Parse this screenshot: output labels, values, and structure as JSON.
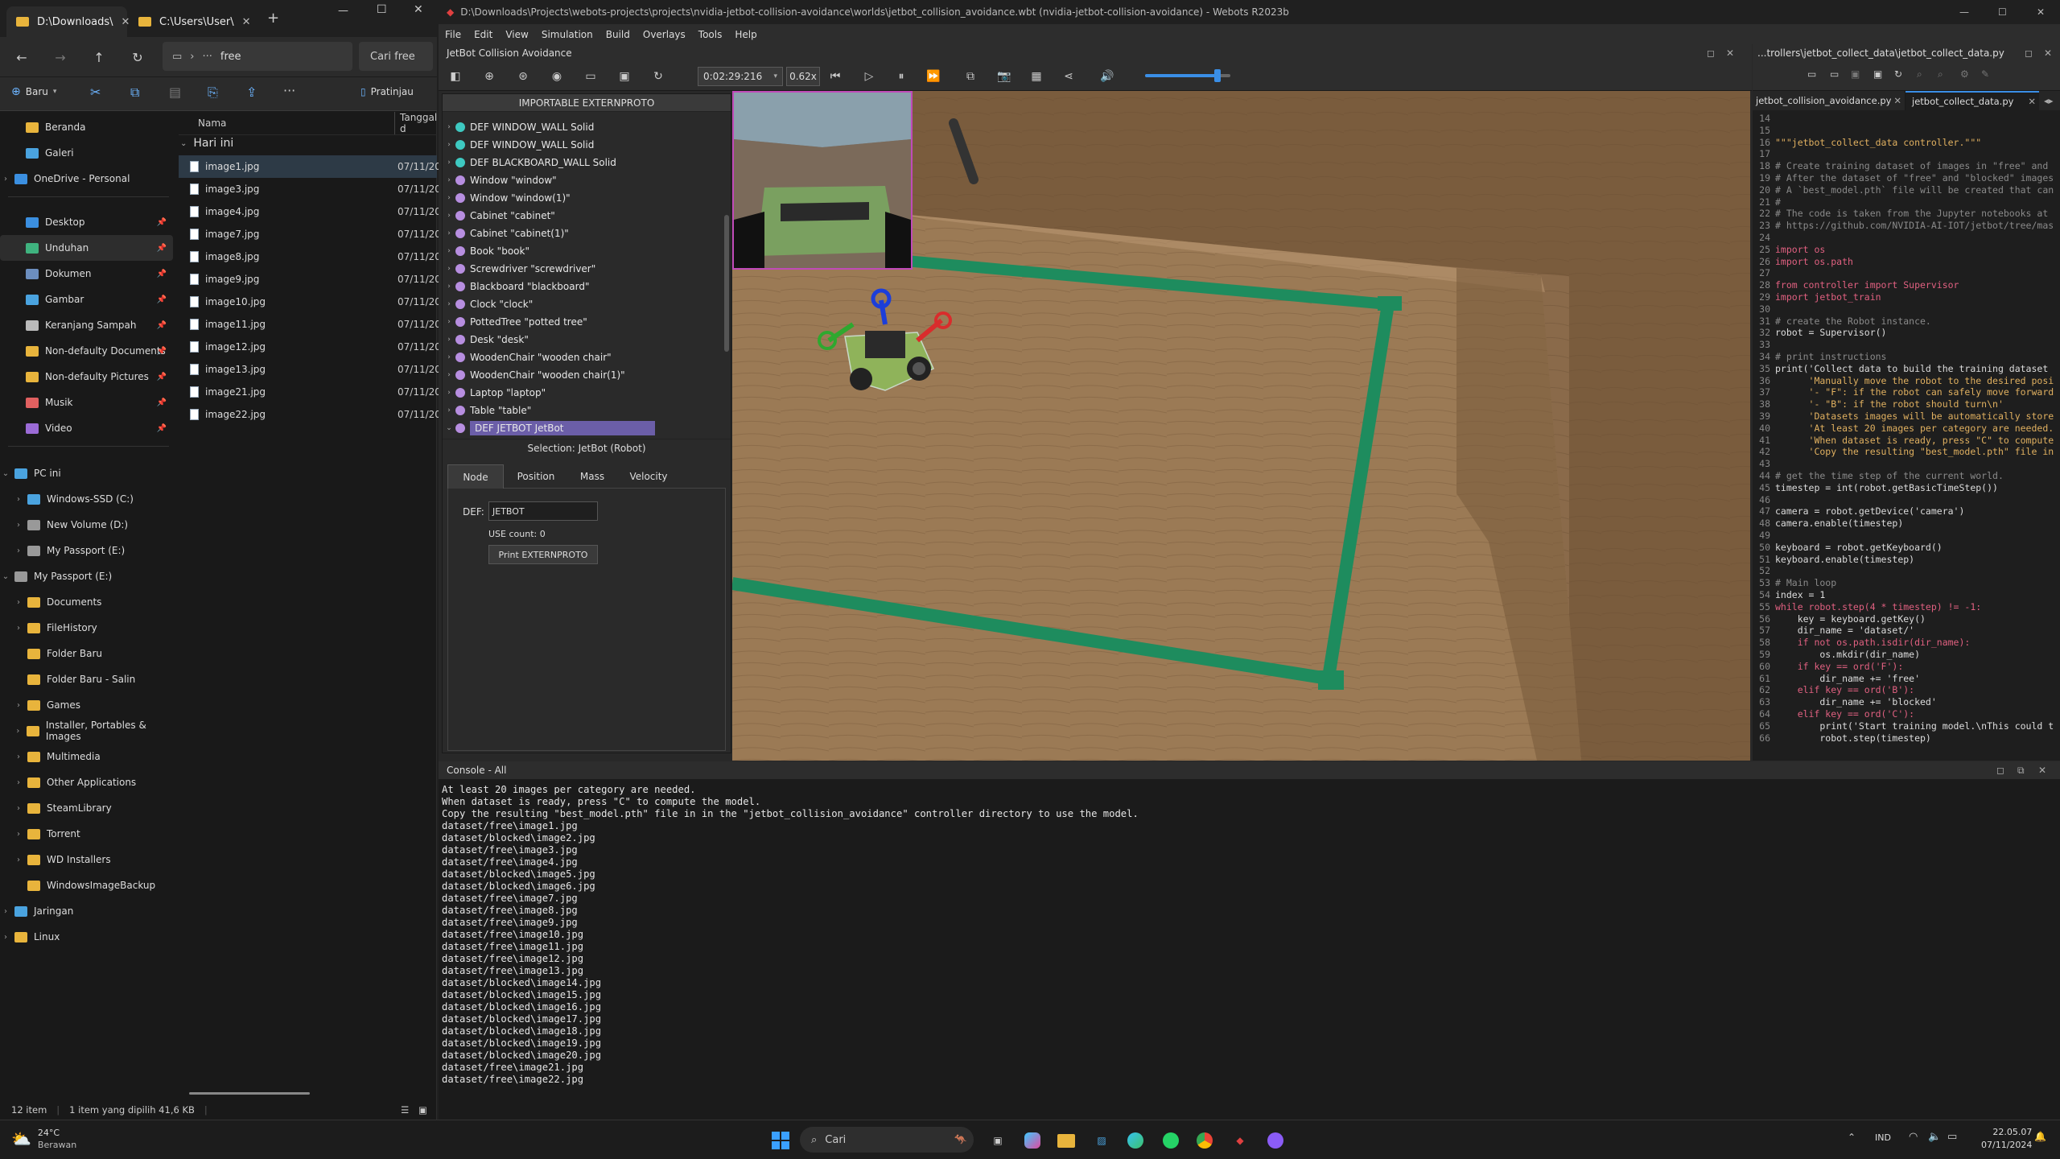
{
  "explorer": {
    "tabs": [
      {
        "label": "D:\\Downloads\\"
      },
      {
        "label": "C:\\Users\\User\\"
      }
    ],
    "path": "free",
    "search_placeholder": "Cari free",
    "new_label": "Baru",
    "preview_label": "Pratinjau",
    "col_name": "Nama",
    "col_date": "Tanggal d",
    "group_label": "Hari ini",
    "sidebar": [
      {
        "label": "Beranda",
        "color": "#e8b43c"
      },
      {
        "label": "Galeri",
        "color": "#4aa3df"
      },
      {
        "label": "OneDrive - Personal",
        "color": "#3b8fe0"
      },
      {
        "label": "Desktop",
        "color": "#3b8fe0"
      },
      {
        "label": "Unduhan",
        "color": "#3fb37f"
      },
      {
        "label": "Dokumen",
        "color": "#6c8ebf"
      },
      {
        "label": "Gambar",
        "color": "#4aa3df"
      },
      {
        "label": "Keranjang Sampah",
        "color": "#bbbbbb"
      },
      {
        "label": "Non-defaulty Documents",
        "color": "#e8b43c"
      },
      {
        "label": "Non-defaulty Pictures",
        "color": "#e8b43c"
      },
      {
        "label": "Musik",
        "color": "#e06060"
      },
      {
        "label": "Video",
        "color": "#9b6bd6"
      },
      {
        "label": "PC ini",
        "color": "#4aa3df"
      },
      {
        "label": "Windows-SSD (C:)",
        "color": "#4aa3df"
      },
      {
        "label": "New Volume (D:)",
        "color": "#999999"
      },
      {
        "label": "My Passport (E:)",
        "color": "#999999"
      },
      {
        "label": "My Passport (E:)",
        "color": "#999999"
      },
      {
        "label": "Documents",
        "color": "#e8b43c"
      },
      {
        "label": "FileHistory",
        "color": "#e8b43c"
      },
      {
        "label": "Folder Baru",
        "color": "#e8b43c"
      },
      {
        "label": "Folder Baru - Salin",
        "color": "#e8b43c"
      },
      {
        "label": "Games",
        "color": "#e8b43c"
      },
      {
        "label": "Installer, Portables & Images",
        "color": "#e8b43c"
      },
      {
        "label": "Multimedia",
        "color": "#e8b43c"
      },
      {
        "label": "Other Applications",
        "color": "#e8b43c"
      },
      {
        "label": "SteamLibrary",
        "color": "#e8b43c"
      },
      {
        "label": "Torrent",
        "color": "#e8b43c"
      },
      {
        "label": "WD Installers",
        "color": "#e8b43c"
      },
      {
        "label": "WindowsImageBackup",
        "color": "#e8b43c"
      },
      {
        "label": "Jaringan",
        "color": "#4aa3df"
      },
      {
        "label": "Linux",
        "color": "#e8b43c"
      }
    ],
    "files": [
      {
        "name": "image1.jpg",
        "date": "07/11/202"
      },
      {
        "name": "image3.jpg",
        "date": "07/11/202"
      },
      {
        "name": "image4.jpg",
        "date": "07/11/202"
      },
      {
        "name": "image7.jpg",
        "date": "07/11/202"
      },
      {
        "name": "image8.jpg",
        "date": "07/11/202"
      },
      {
        "name": "image9.jpg",
        "date": "07/11/202"
      },
      {
        "name": "image10.jpg",
        "date": "07/11/202"
      },
      {
        "name": "image11.jpg",
        "date": "07/11/202"
      },
      {
        "name": "image12.jpg",
        "date": "07/11/202"
      },
      {
        "name": "image13.jpg",
        "date": "07/11/202"
      },
      {
        "name": "image21.jpg",
        "date": "07/11/202"
      },
      {
        "name": "image22.jpg",
        "date": "07/11/202"
      }
    ],
    "status_count": "12 item",
    "status_sel": "1 item yang dipilih  41,6 KB"
  },
  "webots": {
    "title": "D:\\Downloads\\Projects\\webots-projects\\projects\\nvidia-jetbot-collision-avoidance\\worlds\\jetbot_collision_avoidance.wbt (nvidia-jetbot-collision-avoidance) - Webots R2023b",
    "menu": [
      "File",
      "Edit",
      "View",
      "Simulation",
      "Build",
      "Overlays",
      "Tools",
      "Help"
    ],
    "world_title": "JetBot Collision Avoidance",
    "time": "0:02:29:216",
    "speed": "0.62x",
    "volume": 0.85,
    "importable": "IMPORTABLE EXTERNPROTO",
    "tree": [
      {
        "label": "DEF WINDOW_WALL Solid",
        "color": "#3ec9c1"
      },
      {
        "label": "DEF WINDOW_WALL Solid",
        "color": "#3ec9c1"
      },
      {
        "label": "DEF BLACKBOARD_WALL Solid",
        "color": "#3ec9c1"
      },
      {
        "label": "Window \"window\"",
        "color": "#b78ee0"
      },
      {
        "label": "Window \"window(1)\"",
        "color": "#b78ee0"
      },
      {
        "label": "Cabinet \"cabinet\"",
        "color": "#b78ee0"
      },
      {
        "label": "Cabinet \"cabinet(1)\"",
        "color": "#b78ee0"
      },
      {
        "label": "Book \"book\"",
        "color": "#b78ee0"
      },
      {
        "label": "Screwdriver \"screwdriver\"",
        "color": "#b78ee0"
      },
      {
        "label": "Blackboard \"blackboard\"",
        "color": "#b78ee0"
      },
      {
        "label": "Clock \"clock\"",
        "color": "#b78ee0"
      },
      {
        "label": "PottedTree \"potted tree\"",
        "color": "#b78ee0"
      },
      {
        "label": "Desk \"desk\"",
        "color": "#b78ee0"
      },
      {
        "label": "WoodenChair \"wooden chair\"",
        "color": "#b78ee0"
      },
      {
        "label": "WoodenChair \"wooden chair(1)\"",
        "color": "#b78ee0"
      },
      {
        "label": "Laptop \"laptop\"",
        "color": "#b78ee0"
      },
      {
        "label": "Table \"table\"",
        "color": "#b78ee0"
      },
      {
        "label": "DEF JETBOT JetBot",
        "color": "#b78ee0"
      }
    ],
    "selection": "Selection: JetBot (Robot)",
    "node_tabs": [
      "Node",
      "Position",
      "Mass",
      "Velocity"
    ],
    "def_label": "DEF:",
    "def_value": "JETBOT",
    "use_count": "USE count: 0",
    "print_btn": "Print EXTERNPROTO",
    "editor_title": "...trollers\\jetbot_collect_data\\jetbot_collect_data.py",
    "editor_tabs": [
      "jetbot_collision_avoidance.py",
      "jetbot_collect_data.py"
    ],
    "code": [
      {
        "n": "14",
        "t": ""
      },
      {
        "n": "15",
        "t": ""
      },
      {
        "n": "16",
        "t": "\"\"\"jetbot_collect_data controller.\"\"\""
      },
      {
        "n": "17",
        "t": ""
      },
      {
        "n": "18",
        "t": "# Create training dataset of images in \"free\" and"
      },
      {
        "n": "19",
        "t": "# After the dataset of \"free\" and \"blocked\" images"
      },
      {
        "n": "20",
        "t": "# A `best_model.pth` file will be created that can"
      },
      {
        "n": "21",
        "t": "#"
      },
      {
        "n": "22",
        "t": "# The code is taken from the Jupyter notebooks at"
      },
      {
        "n": "23",
        "t": "# https://github.com/NVIDIA-AI-IOT/jetbot/tree/mas"
      },
      {
        "n": "24",
        "t": ""
      },
      {
        "n": "25",
        "t": "import os"
      },
      {
        "n": "26",
        "t": "import os.path"
      },
      {
        "n": "27",
        "t": ""
      },
      {
        "n": "28",
        "t": "from controller import Supervisor"
      },
      {
        "n": "29",
        "t": "import jetbot_train"
      },
      {
        "n": "30",
        "t": ""
      },
      {
        "n": "31",
        "t": "# create the Robot instance."
      },
      {
        "n": "32",
        "t": "robot = Supervisor()"
      },
      {
        "n": "33",
        "t": ""
      },
      {
        "n": "34",
        "t": "# print instructions"
      },
      {
        "n": "35",
        "t": "print('Collect data to build the training dataset"
      },
      {
        "n": "36",
        "t": "      'Manually move the robot to the desired posi"
      },
      {
        "n": "37",
        "t": "      '- \"F\": if the robot can safely move forward"
      },
      {
        "n": "38",
        "t": "      '- \"B\": if the robot should turn\\n'"
      },
      {
        "n": "39",
        "t": "      'Datasets images will be automatically store"
      },
      {
        "n": "40",
        "t": "      'At least 20 images per category are needed."
      },
      {
        "n": "41",
        "t": "      'When dataset is ready, press \"C\" to compute"
      },
      {
        "n": "42",
        "t": "      'Copy the resulting \"best_model.pth\" file in"
      },
      {
        "n": "43",
        "t": ""
      },
      {
        "n": "44",
        "t": "# get the time step of the current world."
      },
      {
        "n": "45",
        "t": "timestep = int(robot.getBasicTimeStep())"
      },
      {
        "n": "46",
        "t": ""
      },
      {
        "n": "47",
        "t": "camera = robot.getDevice('camera')"
      },
      {
        "n": "48",
        "t": "camera.enable(timestep)"
      },
      {
        "n": "49",
        "t": ""
      },
      {
        "n": "50",
        "t": "keyboard = robot.getKeyboard()"
      },
      {
        "n": "51",
        "t": "keyboard.enable(timestep)"
      },
      {
        "n": "52",
        "t": ""
      },
      {
        "n": "53",
        "t": "# Main loop"
      },
      {
        "n": "54",
        "t": "index = 1"
      },
      {
        "n": "55",
        "t": "while robot.step(4 * timestep) != -1:"
      },
      {
        "n": "56",
        "t": "    key = keyboard.getKey()"
      },
      {
        "n": "57",
        "t": "    dir_name = 'dataset/'"
      },
      {
        "n": "58",
        "t": "    if not os.path.isdir(dir_name):"
      },
      {
        "n": "59",
        "t": "        os.mkdir(dir_name)"
      },
      {
        "n": "60",
        "t": "    if key == ord('F'):"
      },
      {
        "n": "61",
        "t": "        dir_name += 'free'"
      },
      {
        "n": "62",
        "t": "    elif key == ord('B'):"
      },
      {
        "n": "63",
        "t": "        dir_name += 'blocked'"
      },
      {
        "n": "64",
        "t": "    elif key == ord('C'):"
      },
      {
        "n": "65",
        "t": "        print('Start training model.\\nThis could t"
      },
      {
        "n": "66",
        "t": "        robot.step(timestep)"
      }
    ],
    "console_title": "Console - All",
    "console": [
      "At least 20 images per category are needed.",
      "When dataset is ready, press \"C\" to compute the model.",
      "Copy the resulting \"best_model.pth\" file in in the \"jetbot_collision_avoidance\" controller directory to use the model.",
      "dataset/free\\image1.jpg",
      "dataset/blocked\\image2.jpg",
      "dataset/free\\image3.jpg",
      "dataset/free\\image4.jpg",
      "dataset/blocked\\image5.jpg",
      "dataset/blocked\\image6.jpg",
      "dataset/free\\image7.jpg",
      "dataset/free\\image8.jpg",
      "dataset/free\\image9.jpg",
      "dataset/free\\image10.jpg",
      "dataset/free\\image11.jpg",
      "dataset/free\\image12.jpg",
      "dataset/free\\image13.jpg",
      "dataset/blocked\\image14.jpg",
      "dataset/blocked\\image15.jpg",
      "dataset/blocked\\image16.jpg",
      "dataset/blocked\\image17.jpg",
      "dataset/blocked\\image18.jpg",
      "dataset/blocked\\image19.jpg",
      "dataset/blocked\\image20.jpg",
      "dataset/free\\image21.jpg",
      "dataset/free\\image22.jpg"
    ]
  },
  "taskbar": {
    "temp": "24°C",
    "weather": "Berawan",
    "search": "Cari",
    "lang": "IND",
    "time": "22.05.07",
    "date": "07/11/2024"
  }
}
